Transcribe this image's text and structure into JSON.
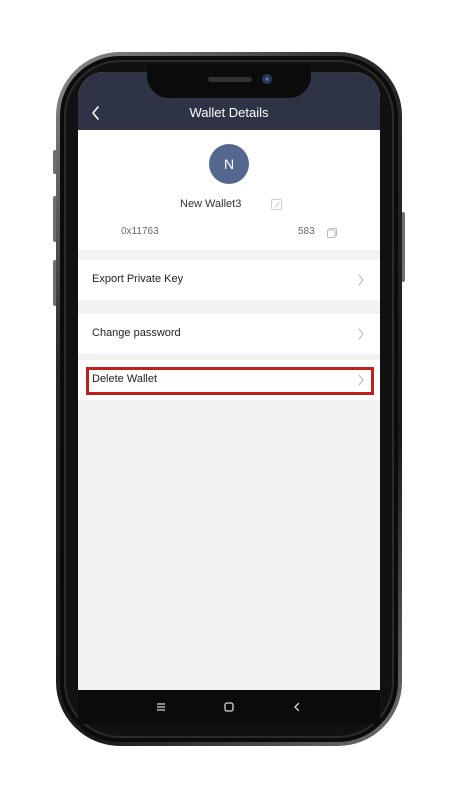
{
  "nav": {
    "title": "Wallet Details"
  },
  "profile": {
    "avatar_initial": "N",
    "wallet_name": "New Wallet3",
    "address_start": "0x11763",
    "address_end": "583"
  },
  "menu": [
    {
      "label": "Export Private Key"
    },
    {
      "label": "Change password"
    },
    {
      "label": "Delete Wallet"
    }
  ],
  "colors": {
    "header_bg": "#2e3446",
    "avatar_bg": "#54678f",
    "highlight_border": "#c0201c"
  },
  "icons": {
    "back": "back-arrow-icon",
    "edit": "edit-icon",
    "copy": "copy-icon",
    "chevron": "chevron-right-icon",
    "recents": "menu-lines-icon",
    "home": "home-square-icon",
    "system_back": "system-back-icon"
  }
}
